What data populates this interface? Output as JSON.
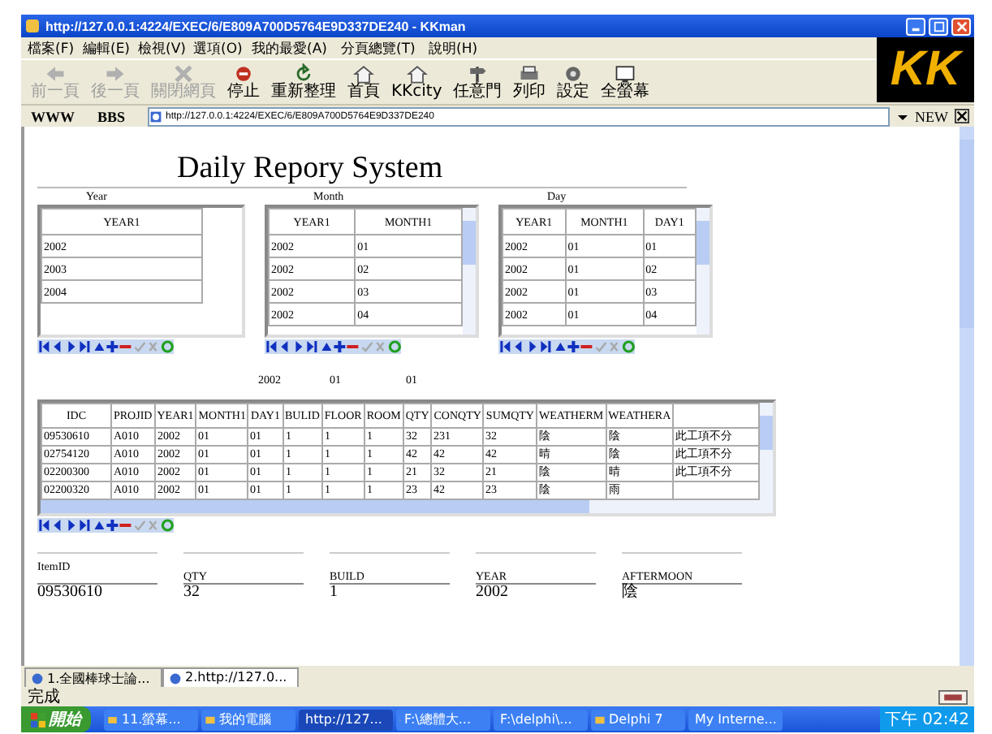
{
  "window": {
    "title": "http://127.0.0.1:4224/EXEC/6/E809A700D5764E9D337DE240 - KKman"
  },
  "menu": [
    "檔案(F)",
    "編輯(E)",
    "檢視(V)",
    "選項(O)",
    "我的最愛(A)",
    "分頁總覽(T)",
    "說明(H)"
  ],
  "toolbar": [
    {
      "kind": "back",
      "label": "前一頁",
      "disabled": true
    },
    {
      "kind": "forward",
      "label": "後一頁",
      "disabled": true
    },
    {
      "kind": "close",
      "label": "關閉網頁",
      "disabled": true
    },
    {
      "kind": "stop",
      "label": "停止",
      "disabled": false
    },
    {
      "kind": "refresh",
      "label": "重新整理",
      "disabled": false
    },
    {
      "kind": "home",
      "label": "首頁",
      "disabled": false
    },
    {
      "kind": "home",
      "label": "KKcity",
      "disabled": false
    },
    {
      "kind": "door",
      "label": "任意門",
      "disabled": false
    },
    {
      "kind": "print",
      "label": "列印",
      "disabled": false
    },
    {
      "kind": "settings",
      "label": "設定",
      "disabled": false
    },
    {
      "kind": "screen",
      "label": "全螢幕",
      "disabled": false
    }
  ],
  "logo": {
    "text": "KK"
  },
  "address_bar": {
    "links": [
      "WWW",
      "BBS"
    ],
    "url": "http://127.0.0.1:4224/EXEC/6/E809A700D5764E9D337DE240",
    "new_label": "NEW"
  },
  "page": {
    "heading": "Daily Repory System",
    "grids": [
      {
        "caption": "Year",
        "columns": [
          "YEAR1"
        ],
        "rows": [
          [
            "2002"
          ],
          [
            "2003"
          ],
          [
            "2004"
          ]
        ],
        "scrollbar": false,
        "navigator": [
          {
            "kind": "first",
            "disabled": false
          },
          {
            "kind": "prior",
            "disabled": false
          },
          {
            "kind": "next",
            "disabled": false
          },
          {
            "kind": "last",
            "disabled": false
          },
          {
            "kind": "insert",
            "disabled": false
          },
          {
            "kind": "add",
            "disabled": false
          },
          {
            "kind": "delete",
            "disabled": false
          },
          {
            "kind": "post",
            "disabled": true
          },
          {
            "kind": "cancel",
            "disabled": true
          },
          {
            "kind": "refresh",
            "disabled": false
          }
        ]
      },
      {
        "caption": "Month",
        "columns": [
          "YEAR1",
          "MONTH1"
        ],
        "rows": [
          [
            "2002",
            "01"
          ],
          [
            "2002",
            "02"
          ],
          [
            "2002",
            "03"
          ],
          [
            "2002",
            "04"
          ]
        ],
        "scrollbar": true,
        "navigator": [
          {
            "kind": "first",
            "disabled": false
          },
          {
            "kind": "prior",
            "disabled": false
          },
          {
            "kind": "next",
            "disabled": false
          },
          {
            "kind": "last",
            "disabled": false
          },
          {
            "kind": "insert",
            "disabled": false
          },
          {
            "kind": "add",
            "disabled": false
          },
          {
            "kind": "delete",
            "disabled": false
          },
          {
            "kind": "post",
            "disabled": true
          },
          {
            "kind": "cancel",
            "disabled": true
          },
          {
            "kind": "refresh",
            "disabled": false
          }
        ]
      },
      {
        "caption": "Day",
        "columns": [
          "YEAR1",
          "MONTH1",
          "DAY1"
        ],
        "rows": [
          [
            "2002",
            "01",
            "01"
          ],
          [
            "2002",
            "01",
            "02"
          ],
          [
            "2002",
            "01",
            "03"
          ],
          [
            "2002",
            "01",
            "04"
          ]
        ],
        "scrollbar": true,
        "navigator": [
          {
            "kind": "first",
            "disabled": false
          },
          {
            "kind": "prior",
            "disabled": false
          },
          {
            "kind": "next",
            "disabled": false
          },
          {
            "kind": "last",
            "disabled": false
          },
          {
            "kind": "insert",
            "disabled": false
          },
          {
            "kind": "add",
            "disabled": false
          },
          {
            "kind": "delete",
            "disabled": false
          },
          {
            "kind": "post",
            "disabled": true
          },
          {
            "kind": "cancel",
            "disabled": true
          },
          {
            "kind": "refresh",
            "disabled": false
          }
        ]
      }
    ],
    "selection": [
      "2002",
      "01",
      "01"
    ],
    "detail_grid": {
      "columns": [
        "IDC",
        "PROJID",
        "YEAR1",
        "MONTH1",
        "DAY1",
        "BULID",
        "FLOOR",
        "ROOM",
        "QTY",
        "CONQTY",
        "SUMQTY",
        "WEATHERM",
        "WEATHERA"
      ],
      "rows": [
        [
          "09530610",
          "A010",
          "2002",
          "01",
          "01",
          "1",
          "1",
          "1",
          "32",
          "231",
          "32",
          "陰",
          "陰",
          "此工項不分"
        ],
        [
          "02754120",
          "A010",
          "2002",
          "01",
          "01",
          "1",
          "1",
          "1",
          "42",
          "42",
          "42",
          "晴",
          "陰",
          "此工項不分"
        ],
        [
          "02200300",
          "A010",
          "2002",
          "01",
          "01",
          "1",
          "1",
          "1",
          "21",
          "32",
          "21",
          "陰",
          "晴",
          "此工項不分"
        ],
        [
          "02200320",
          "A010",
          "2002",
          "01",
          "01",
          "1",
          "1",
          "1",
          "23",
          "42",
          "23",
          "陰",
          "雨",
          ""
        ]
      ],
      "navigator": [
        {
          "kind": "first",
          "disabled": false
        },
        {
          "kind": "prior",
          "disabled": false
        },
        {
          "kind": "next",
          "disabled": false
        },
        {
          "kind": "last",
          "disabled": false
        },
        {
          "kind": "insert",
          "disabled": false
        },
        {
          "kind": "add",
          "disabled": false
        },
        {
          "kind": "delete",
          "disabled": false
        },
        {
          "kind": "post",
          "disabled": true
        },
        {
          "kind": "cancel",
          "disabled": true
        },
        {
          "kind": "refresh",
          "disabled": false
        }
      ]
    },
    "form": [
      {
        "label": "ItemID",
        "value": "09530610"
      },
      {
        "label": "QTY",
        "value": "32"
      },
      {
        "label": "BUILD",
        "value": "1"
      },
      {
        "label": "YEAR",
        "value": "2002"
      },
      {
        "label": "AFTERMOON",
        "value": "陰"
      }
    ]
  },
  "page_tabs": [
    {
      "label": "1.全國棒球士論...",
      "selected": false
    },
    {
      "label": "2.http://127.0...",
      "selected": true
    }
  ],
  "status_bar": {
    "text": "完成"
  },
  "taskbar": {
    "start": "開始",
    "items": [
      {
        "label": "11.螢幕...",
        "selected": false
      },
      {
        "label": "我的電腦",
        "selected": false
      },
      {
        "label": "http://127...",
        "selected": true
      },
      {
        "label": "F:\\總體大...",
        "selected": false
      },
      {
        "label": "F:\\delphi\\...",
        "selected": false
      },
      {
        "label": "Delphi 7",
        "selected": false
      },
      {
        "label": "My Interne...",
        "selected": false
      }
    ],
    "clock": "下午 02:42"
  }
}
